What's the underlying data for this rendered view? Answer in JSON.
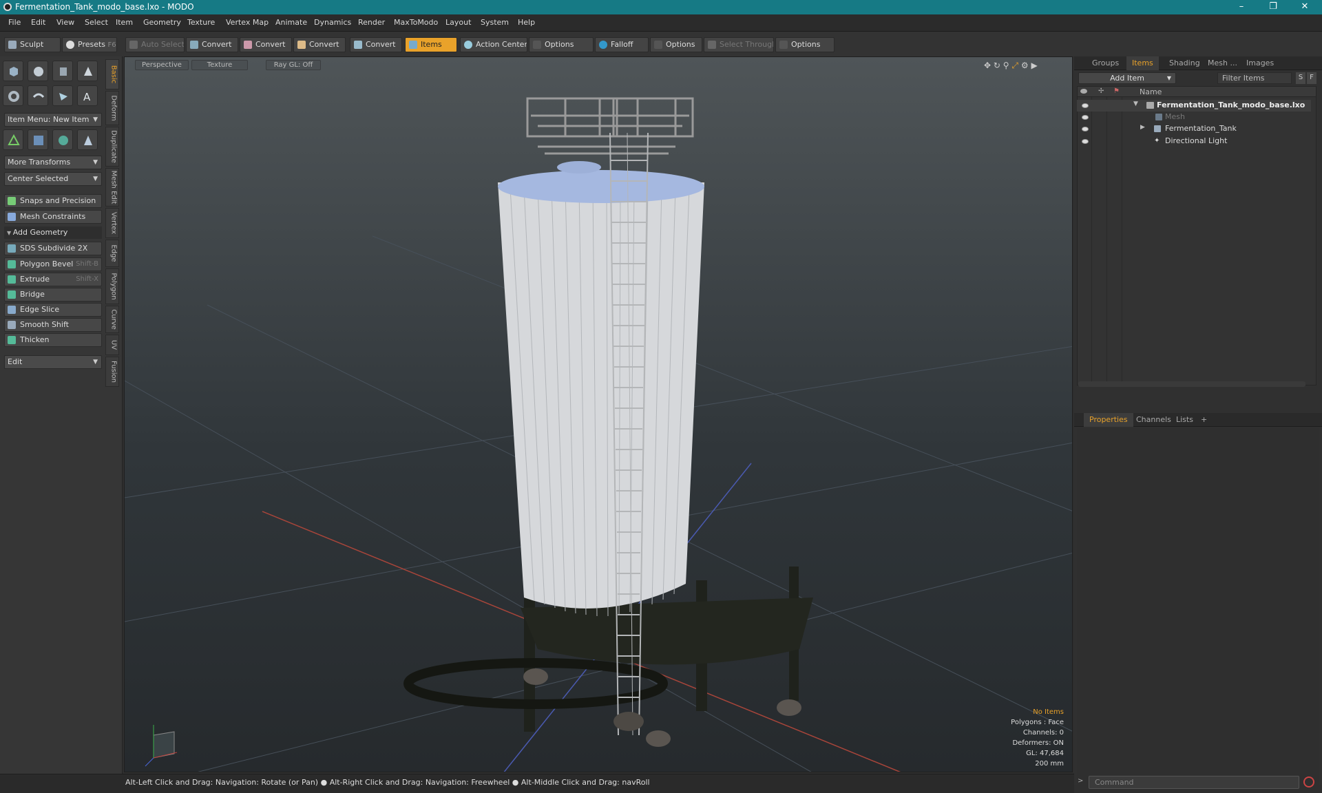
{
  "window": {
    "title": "Fermentation_Tank_modo_base.lxo - MODO",
    "min": "–",
    "max": "❐",
    "close": "✕"
  },
  "menu": [
    "File",
    "Edit",
    "View",
    "Select",
    "Item",
    "Geometry",
    "Texture",
    "Vertex Map",
    "Animate",
    "Dynamics",
    "Render",
    "MaxToModo",
    "Layout",
    "System",
    "Help"
  ],
  "toolbar": {
    "sculpt": "Sculpt",
    "presets": "Presets",
    "presets_key": "F6",
    "auto_select": "Auto Select",
    "convert1": "Convert",
    "convert2": "Convert",
    "convert3": "Convert",
    "convert4": "Convert",
    "items": "Items",
    "action_center": "Action Center",
    "options1": "Options",
    "falloff": "Falloff",
    "options2": "Options",
    "select_through": "Select Through",
    "options3": "Options"
  },
  "left": {
    "item_menu": "Item Menu: New Item",
    "more_transforms": "More Transforms",
    "center_selected": "Center Selected",
    "snaps": "Snaps and Precision",
    "constraints": "Mesh Constraints",
    "add_geometry": "Add Geometry",
    "tools": [
      {
        "label": "SDS Subdivide 2X",
        "key": ""
      },
      {
        "label": "Polygon Bevel",
        "key": "Shift-B"
      },
      {
        "label": "Extrude",
        "key": "Shift-X"
      },
      {
        "label": "Bridge",
        "key": ""
      },
      {
        "label": "Edge Slice",
        "key": ""
      },
      {
        "label": "Smooth Shift",
        "key": ""
      },
      {
        "label": "Thicken",
        "key": ""
      }
    ],
    "edit": "Edit"
  },
  "vtabs": [
    "Basic",
    "Deform",
    "Duplicate",
    "Mesh Edit",
    "Vertex",
    "Edge",
    "Polygon",
    "Curve",
    "UV",
    "Fusion"
  ],
  "viewport": {
    "view": "Perspective",
    "shading": "Texture",
    "raygl": "Ray GL: Off",
    "info": {
      "items": "No Items",
      "polygons": "Polygons : Face",
      "channels": "Channels: 0",
      "deformers": "Deformers: ON",
      "gl": "GL: 47,684",
      "scale": "200 mm"
    }
  },
  "right": {
    "tabs": [
      "Groups",
      "Items",
      "Shading",
      "Mesh ...",
      "Images"
    ],
    "add_item": "Add Item",
    "filter": "Filter Items",
    "s": "S",
    "f": "F",
    "col_name": "Name",
    "tree": [
      {
        "label": "Fermentation_Tank_modo_base.lxo"
      },
      {
        "label": "Mesh"
      },
      {
        "label": "Fermentation_Tank"
      },
      {
        "label": "Directional Light"
      }
    ],
    "lower_tabs": [
      "Properties",
      "Channels",
      "Lists"
    ]
  },
  "status": {
    "hint": "Alt-Left Click and Drag: Navigation: Rotate (or Pan) ● Alt-Right Click and Drag: Navigation: Freewheel ● Alt-Middle Click and Drag: navRoll"
  },
  "command": {
    "placeholder": "Command"
  }
}
